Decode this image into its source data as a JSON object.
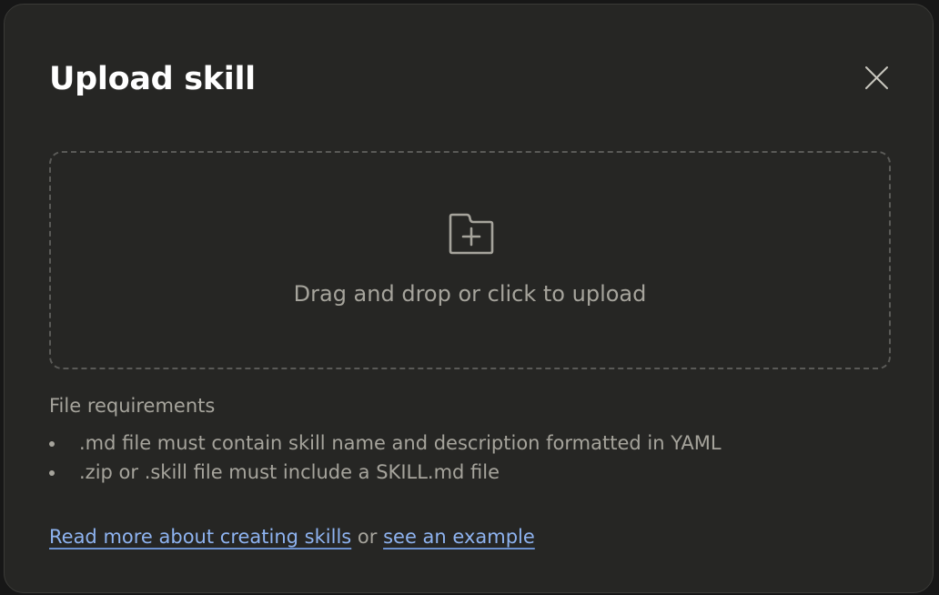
{
  "dialog": {
    "title": "Upload skill",
    "close_icon": "close-icon"
  },
  "dropzone": {
    "icon": "folder-plus-icon",
    "text": "Drag and drop or click to upload"
  },
  "requirements": {
    "heading": "File requirements",
    "items": [
      {
        "text": ".md file must contain skill name and description formatted in YAML"
      },
      {
        "text": ".zip or .skill file must include a SKILL.md file"
      }
    ]
  },
  "footer": {
    "read_more_link": "Read more about creating skills",
    "separator": "or",
    "example_link": "see an example"
  },
  "colors": {
    "background": "#262624",
    "title": "#ffffff",
    "muted_text": "#a6a49c",
    "link": "#8eb3f0",
    "dashed_border": "#5a5a57"
  }
}
